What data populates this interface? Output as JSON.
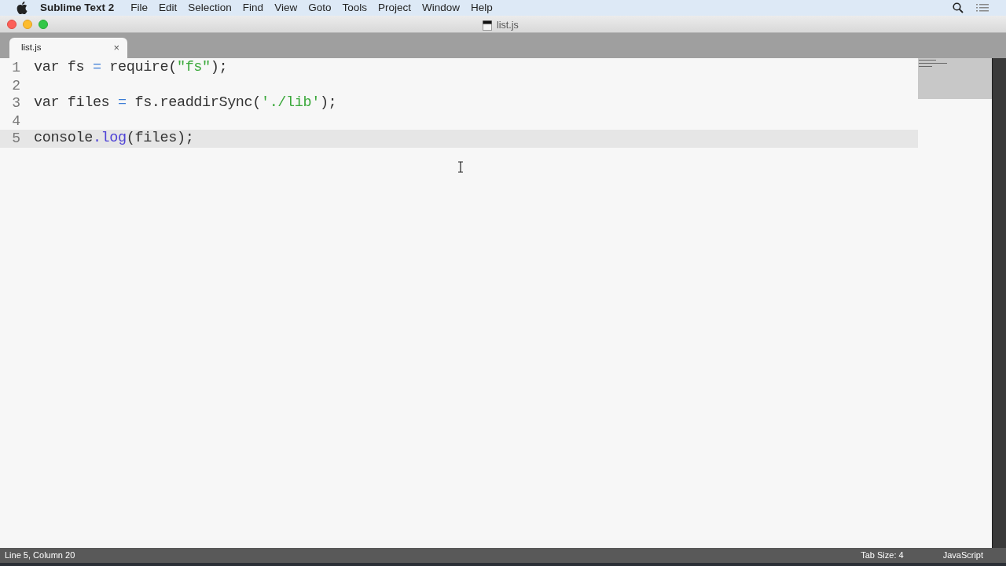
{
  "menu_bar": {
    "app_name": "Sublime Text 2",
    "items": [
      "File",
      "Edit",
      "Selection",
      "Find",
      "View",
      "Goto",
      "Tools",
      "Project",
      "Window",
      "Help"
    ]
  },
  "window": {
    "title": "list.js"
  },
  "tabs": [
    {
      "label": "list.js",
      "selected": true,
      "close": "×"
    }
  ],
  "editor": {
    "lines": [
      {
        "number": "1",
        "current": false,
        "tokens": [
          {
            "kind": "plain",
            "text": "var fs "
          },
          {
            "kind": "operator",
            "text": "="
          },
          {
            "kind": "plain",
            "text": " require("
          },
          {
            "kind": "string",
            "text": "\"fs\""
          },
          {
            "kind": "plain",
            "text": ");"
          }
        ]
      },
      {
        "number": "2",
        "current": false
      },
      {
        "number": "3",
        "current": false,
        "tokens": [
          {
            "kind": "plain",
            "text": "var files "
          },
          {
            "kind": "operator",
            "text": "="
          },
          {
            "kind": "plain",
            "text": " fs.readdirSync("
          },
          {
            "kind": "string",
            "text": "'./lib'"
          },
          {
            "kind": "plain",
            "text": ");"
          }
        ]
      },
      {
        "number": "4",
        "current": false
      },
      {
        "number": "5",
        "current": true,
        "tokens": [
          {
            "kind": "plain",
            "text": "console"
          },
          {
            "kind": "method",
            "text": ".log"
          },
          {
            "kind": "plain",
            "text": "(files);"
          }
        ]
      }
    ]
  },
  "status_bar": {
    "position": "Line 5, Column 20",
    "tab_size": "Tab Size: 4",
    "syntax": "JavaScript"
  }
}
